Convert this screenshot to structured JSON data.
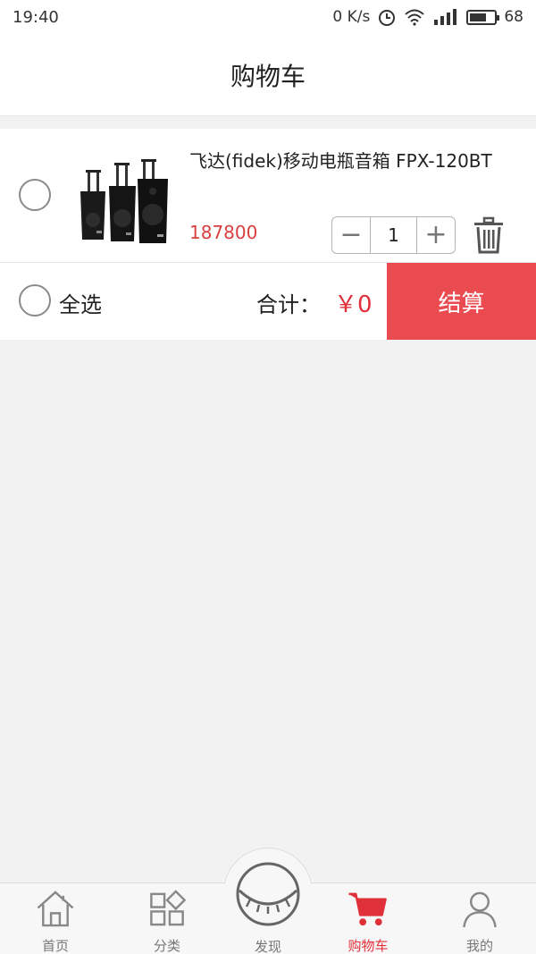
{
  "status_bar": {
    "time": "19:40",
    "net_speed": "0 K/s",
    "battery": "68",
    "battery_level": 0.68
  },
  "nav": {
    "title": "购物车"
  },
  "cart": {
    "items": [
      {
        "title": "飞达(fidek)移动电瓶音箱 FPX-120BT",
        "price": "187800",
        "quantity": "1",
        "minus": "−",
        "plus": "+"
      }
    ]
  },
  "footer": {
    "select_all": "全选",
    "total_label": "合计：",
    "total_value": "￥0",
    "checkout": "结算"
  },
  "tabs": [
    {
      "label": "首页",
      "icon": "home-icon",
      "active": false
    },
    {
      "label": "分类",
      "icon": "category-icon",
      "active": false
    },
    {
      "label": "发现",
      "icon": "discover-icon",
      "active": false
    },
    {
      "label": "购物车",
      "icon": "cart-icon",
      "active": true
    },
    {
      "label": "我的",
      "icon": "user-icon",
      "active": false
    }
  ],
  "colors": {
    "accent": "#e94b51",
    "price": "#d9403f",
    "background": "#f2f2f2"
  }
}
